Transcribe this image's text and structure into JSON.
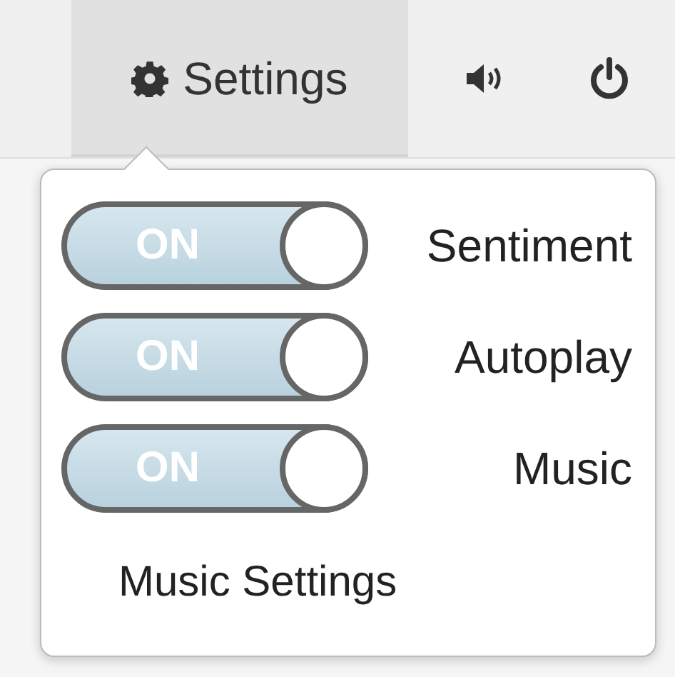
{
  "toolbar": {
    "items": [
      {
        "kind": "settings",
        "label": "Settings",
        "selected": true
      },
      {
        "kind": "sound",
        "selected": false
      },
      {
        "kind": "power",
        "selected": false
      }
    ]
  },
  "popover": {
    "toggles": [
      {
        "label": "Sentiment",
        "on": true,
        "state_text": "ON"
      },
      {
        "label": "Autoplay",
        "on": true,
        "state_text": "ON"
      },
      {
        "label": "Music",
        "on": true,
        "state_text": "ON"
      }
    ],
    "link": "Music Settings"
  }
}
